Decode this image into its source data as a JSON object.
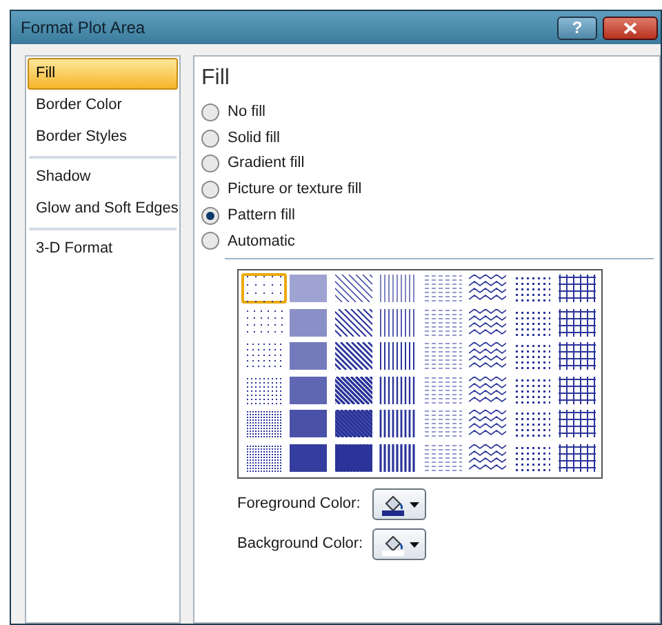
{
  "window": {
    "title": "Format Plot Area",
    "buttons": [
      {
        "kind": "help",
        "label": "?"
      },
      {
        "kind": "close"
      }
    ]
  },
  "sidebar": {
    "items": [
      {
        "label": "Fill",
        "selected": true
      },
      {
        "label": "Border Color",
        "selected": false
      },
      {
        "label": "Border Styles",
        "selected": false
      },
      {
        "label": "Shadow",
        "selected": false
      },
      {
        "label": "Glow and Soft Edges",
        "selected": false
      },
      {
        "label": "3-D Format",
        "selected": false
      }
    ]
  },
  "panel": {
    "heading": "Fill",
    "options": [
      {
        "label": "No fill",
        "selected": false
      },
      {
        "label": "Solid fill",
        "selected": false
      },
      {
        "label": "Gradient fill",
        "selected": false
      },
      {
        "label": "Picture or texture fill",
        "selected": false
      },
      {
        "label": "Pattern fill",
        "selected": true
      },
      {
        "label": "Automatic",
        "selected": false
      }
    ],
    "patterns": [
      {
        "selected": true
      },
      {
        "selected": false
      },
      {
        "selected": false
      },
      {
        "selected": false
      },
      {
        "selected": false
      },
      {
        "selected": false
      },
      {
        "selected": false
      },
      {
        "selected": false
      },
      {
        "selected": false
      },
      {
        "selected": false
      },
      {
        "selected": false
      },
      {
        "selected": false
      },
      {
        "selected": false
      },
      {
        "selected": false
      },
      {
        "selected": false
      },
      {
        "selected": false
      },
      {
        "selected": false
      },
      {
        "selected": false
      },
      {
        "selected": false
      },
      {
        "selected": false
      },
      {
        "selected": false
      },
      {
        "selected": false
      },
      {
        "selected": false
      },
      {
        "selected": false
      },
      {
        "selected": false
      },
      {
        "selected": false
      },
      {
        "selected": false
      },
      {
        "selected": false
      },
      {
        "selected": false
      },
      {
        "selected": false
      },
      {
        "selected": false
      },
      {
        "selected": false
      },
      {
        "selected": false
      },
      {
        "selected": false
      },
      {
        "selected": false
      },
      {
        "selected": false
      },
      {
        "selected": false
      },
      {
        "selected": false
      },
      {
        "selected": false
      },
      {
        "selected": false
      },
      {
        "selected": false
      },
      {
        "selected": false
      },
      {
        "selected": false
      },
      {
        "selected": false
      },
      {
        "selected": false
      },
      {
        "selected": false
      },
      {
        "selected": false
      },
      {
        "selected": false
      }
    ],
    "color_pickers": [
      {
        "label": "Foreground Color:",
        "color": "#1f2a8a"
      },
      {
        "label": "Background Color:",
        "color": "#ffffff"
      }
    ]
  }
}
